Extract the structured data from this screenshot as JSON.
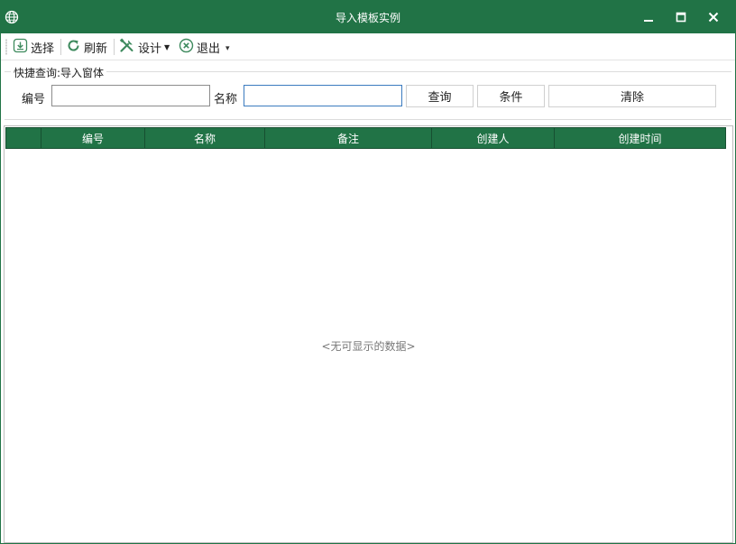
{
  "window": {
    "title": "导入模板实例",
    "icon": "globe-icon",
    "controls": [
      "minimize-icon",
      "maximize-icon",
      "close-icon"
    ]
  },
  "toolbar": {
    "select_label": "选择",
    "refresh_label": "刷新",
    "design_label": "设计",
    "exit_label": "退出",
    "design_caret": "▼",
    "overflow_glyph": "▾"
  },
  "quick_search": {
    "legend": "快捷查询:导入窗体",
    "code_label": "编号",
    "code_value": "",
    "name_label": "名称",
    "name_value": "",
    "query_button": "查询",
    "condition_button": "条件",
    "clear_button": "清除"
  },
  "grid": {
    "columns": [
      "",
      "编号",
      "名称",
      "备注",
      "创建人",
      "创建时间"
    ],
    "rows": [],
    "empty_text": "<无可显示的数据>"
  },
  "colors": {
    "accent": "#217346",
    "header_border": "#174f31",
    "icon_green": "#3e8a5e"
  }
}
